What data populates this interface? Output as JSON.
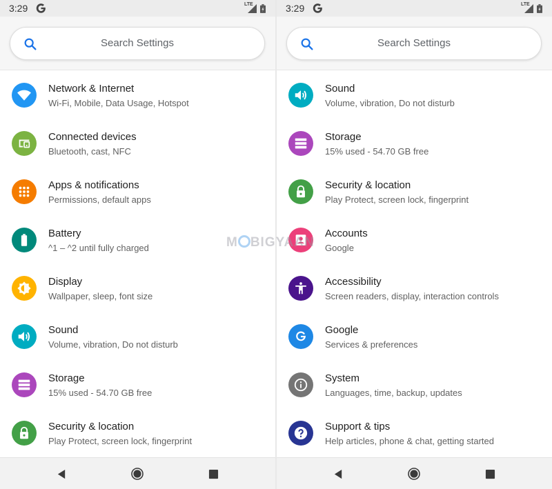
{
  "screens": [
    {
      "status": {
        "time": "3:29",
        "network": "LTE"
      },
      "search": {
        "placeholder": "Search Settings"
      },
      "items": [
        {
          "title": "Network & Internet",
          "subtitle": "Wi-Fi, Mobile, Data Usage, Hotspot",
          "icon": "wifi-icon",
          "color": "#2196f3"
        },
        {
          "title": "Connected devices",
          "subtitle": "Bluetooth, cast, NFC",
          "icon": "devices-icon",
          "color": "#7cb342"
        },
        {
          "title": "Apps & notifications",
          "subtitle": "Permissions, default apps",
          "icon": "apps-icon",
          "color": "#f57c00"
        },
        {
          "title": "Battery",
          "subtitle": "^1 – ^2 until fully charged",
          "icon": "battery-icon",
          "color": "#00897b"
        },
        {
          "title": "Display",
          "subtitle": "Wallpaper, sleep, font size",
          "icon": "brightness-icon",
          "color": "#ffb300"
        },
        {
          "title": "Sound",
          "subtitle": "Volume, vibration, Do not disturb",
          "icon": "volume-icon",
          "color": "#00acc1"
        },
        {
          "title": "Storage",
          "subtitle": "15% used - 54.70 GB free",
          "icon": "storage-icon",
          "color": "#ab47bc"
        },
        {
          "title": "Security & location",
          "subtitle": "Play Protect, screen lock, fingerprint",
          "icon": "lock-icon",
          "color": "#43a047"
        }
      ]
    },
    {
      "status": {
        "time": "3:29",
        "network": "LTE"
      },
      "search": {
        "placeholder": "Search Settings"
      },
      "items": [
        {
          "title": "Sound",
          "subtitle": "Volume, vibration, Do not disturb",
          "icon": "volume-icon",
          "color": "#00acc1"
        },
        {
          "title": "Storage",
          "subtitle": "15% used - 54.70 GB free",
          "icon": "storage-icon",
          "color": "#ab47bc"
        },
        {
          "title": "Security & location",
          "subtitle": "Play Protect, screen lock, fingerprint",
          "icon": "lock-icon",
          "color": "#43a047"
        },
        {
          "title": "Accounts",
          "subtitle": "Google",
          "icon": "account-icon",
          "color": "#ec407a"
        },
        {
          "title": "Accessibility",
          "subtitle": "Screen readers, display, interaction controls",
          "icon": "accessibility-icon",
          "color": "#4a148c"
        },
        {
          "title": "Google",
          "subtitle": "Services & preferences",
          "icon": "google-g-icon",
          "color": "#1e88e5"
        },
        {
          "title": "System",
          "subtitle": "Languages, time, backup, updates",
          "icon": "info-icon",
          "color": "#757575"
        },
        {
          "title": "Support & tips",
          "subtitle": "Help articles, phone & chat, getting started",
          "icon": "help-icon",
          "color": "#283593"
        }
      ]
    }
  ],
  "watermark": {
    "prefix": "M",
    "suffix": "BIGYAAN"
  }
}
